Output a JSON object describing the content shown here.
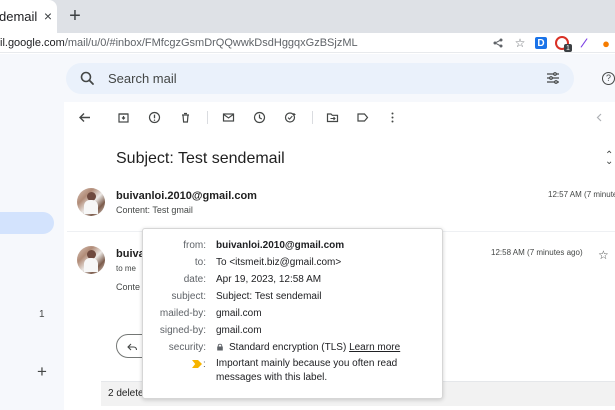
{
  "browser": {
    "tab_title": "demail - ",
    "url_domain": "il.google.com",
    "url_path": "/mail/u/0/#inbox/FMfcgzGsmDrQQwwkDsdHggqxGzBSjzML",
    "extension_badge": "1"
  },
  "gmail": {
    "search_placeholder": "Search mail",
    "left_count": "1",
    "subject": "Subject: Test sendemail",
    "messages": [
      {
        "sender": "buivanloi.2010@gmail.com",
        "snippet": "Content: Test gmail",
        "time": "12:57 AM (7 minute"
      },
      {
        "partial_sender": "buiva",
        "to_me": "to me",
        "partial_content": "Conte",
        "time": "12:58 AM (7 minutes ago)"
      }
    ],
    "bottom_text": "2 delete"
  },
  "details": {
    "from_label": "from:",
    "from_value": "buivanloi.2010@gmail.com",
    "to_label": "to:",
    "to_value": "To <itsmeit.biz@gmail.com>",
    "date_label": "date:",
    "date_value": "Apr 19, 2023, 12:58 AM",
    "subject_label": "subject:",
    "subject_value": "Subject: Test sendemail",
    "mailed_by_label": "mailed-by:",
    "mailed_by_value": "gmail.com",
    "signed_by_label": "signed-by:",
    "signed_by_value": "gmail.com",
    "security_label": "security:",
    "security_value": "Standard encryption (TLS)",
    "security_link": "Learn more",
    "importance_colon": ":",
    "importance_text": "Important mainly because you often read messages with this label."
  },
  "colors": {
    "gmail_background": "#f6f8fc",
    "selected_nav": "#d3e3fd",
    "importance": "#f6b400",
    "extension_red": "#d93025",
    "extension_blue": "#1a73e8"
  },
  "icons": [
    "close-icon",
    "new-tab-icon",
    "share-icon",
    "star-icon",
    "search-icon",
    "filters-icon",
    "help-icon",
    "back-icon",
    "archive-icon",
    "report-icon",
    "delete-icon",
    "mark-unread-icon",
    "snooze-icon",
    "add-task-icon",
    "move-icon",
    "label-icon",
    "more-icon",
    "lock-icon",
    "importance-icon"
  ]
}
